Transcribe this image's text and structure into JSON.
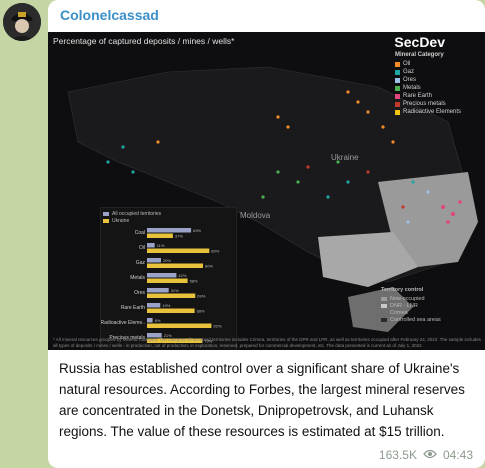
{
  "channel": {
    "name": "Colonelcassad"
  },
  "map": {
    "title": "Percentage of captured deposits / mines / wells*",
    "brand": "SecDev",
    "labels": {
      "ukraine": "Ukraine",
      "moldova": "Moldova"
    },
    "legend": {
      "title": "Mineral Category",
      "items": [
        {
          "label": "Oil",
          "color": "#f28c28"
        },
        {
          "label": "Gaz",
          "color": "#1fa6a0"
        },
        {
          "label": "Ores",
          "color": "#9ec1e6"
        },
        {
          "label": "Metals",
          "color": "#4caf50"
        },
        {
          "label": "Rare Earth",
          "color": "#e0457b"
        },
        {
          "label": "Precious metals",
          "color": "#c0392b"
        },
        {
          "label": "Radioactive Elements",
          "color": "#f1c40f"
        }
      ]
    },
    "territory": {
      "title": "Territory control",
      "items": [
        {
          "label": "Now occupied",
          "color": "#9a9a9a"
        },
        {
          "label": "DNR - LNR",
          "color": "#c8c8c8"
        },
        {
          "label": "Crimea",
          "color": "#6e6e6e"
        },
        {
          "label": "Controlled sea areas",
          "color": "#2a2a2a"
        }
      ]
    },
    "footnote": "* All mineral resources grouped by Mineral Category. The category All occupied territories includes Crimea, territories of the DPR and LPR, as well as territories occupied after February 24, 2022. The sample includes all types of deposits / mines / wells - in production, out of production, in exploration, reserved, prepared for commercial development, etc. The data presented is current as of July 1, 2022."
  },
  "chart_data": {
    "type": "bar",
    "legend": [
      "All occupied territories",
      "Ukraine"
    ],
    "categories": [
      "Coal",
      "Oil",
      "Gaz",
      "Metals",
      "Ores",
      "Rare Earth",
      "Radioactive Eleme..",
      "Precious metals"
    ],
    "series": [
      {
        "name": "All occupied territories",
        "color": "#9aa3c7",
        "values": [
          63,
          11,
          20,
          42,
          31,
          19,
          8,
          21
        ]
      },
      {
        "name": "Ukraine",
        "color": "#e8c23a",
        "values": [
          37,
          89,
          80,
          58,
          69,
          68,
          92,
          79
        ]
      }
    ],
    "xlim": [
      0,
      100
    ]
  },
  "message": {
    "text": "Russia has established control over a significant share of Ukraine's natural resources. According to Forbes, the largest mineral reserves are concentrated in the Donetsk, Dnipropetrovsk, and Luhansk regions. The value of these resources is estimated at $15 trillion.",
    "views": "163.5K",
    "time": "04:43"
  }
}
